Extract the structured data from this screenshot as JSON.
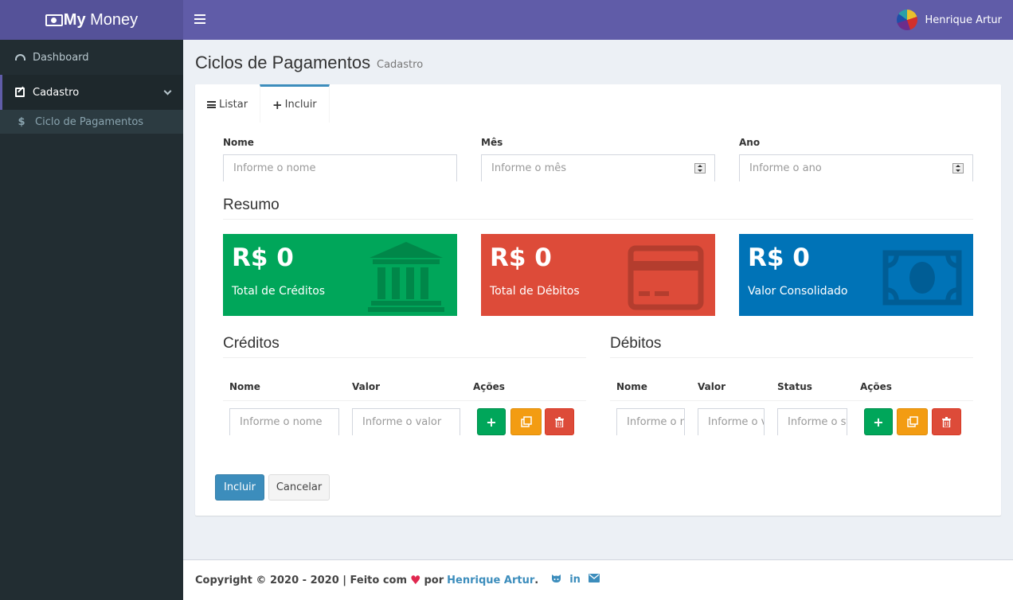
{
  "brand": {
    "bold": "My",
    "rest": " Money"
  },
  "header": {
    "user_name": "Henrique Artur"
  },
  "sidebar": {
    "items": [
      {
        "label": "Dashboard",
        "icon": "dashboard-icon"
      },
      {
        "label": "Cadastro",
        "icon": "edit-icon"
      }
    ],
    "subitems": [
      {
        "label": "Ciclo de Pagamentos",
        "icon": "dollar-icon"
      }
    ]
  },
  "page": {
    "title": "Ciclos de Pagamentos",
    "subtitle": "Cadastro"
  },
  "tabs": [
    {
      "label": "Listar"
    },
    {
      "label": "Incluir"
    }
  ],
  "form": {
    "nome": {
      "label": "Nome",
      "placeholder": "Informe o nome"
    },
    "mes": {
      "label": "Mês",
      "placeholder": "Informe o mês"
    },
    "ano": {
      "label": "Ano",
      "placeholder": "Informe o ano"
    }
  },
  "resumo": {
    "title": "Resumo",
    "cards": [
      {
        "value": "R$ 0",
        "caption": "Total de Créditos",
        "color": "#00a65a",
        "icon": "bank-icon"
      },
      {
        "value": "R$ 0",
        "caption": "Total de Débitos",
        "color": "#dd4b39",
        "icon": "credit-card-icon"
      },
      {
        "value": "R$ 0",
        "caption": "Valor Consolidado",
        "color": "#0073b7",
        "icon": "money-icon"
      }
    ]
  },
  "creditos": {
    "title": "Créditos",
    "headers": [
      "Nome",
      "Valor",
      "Ações"
    ],
    "placeholders": {
      "nome": "Informe o nome",
      "valor": "Informe o valor"
    }
  },
  "debitos": {
    "title": "Débitos",
    "headers": [
      "Nome",
      "Valor",
      "Status",
      "Ações"
    ],
    "placeholders": {
      "nome": "Informe o nome",
      "valor": "Informe o valor",
      "status": "Informe o status"
    }
  },
  "actions": {
    "submit": "Incluir",
    "cancel": "Cancelar"
  },
  "footer": {
    "copyright": "Copyright © 2020 - 2020 | Feito com",
    "by": "por",
    "author": "Henrique Artur",
    "dot": "."
  }
}
